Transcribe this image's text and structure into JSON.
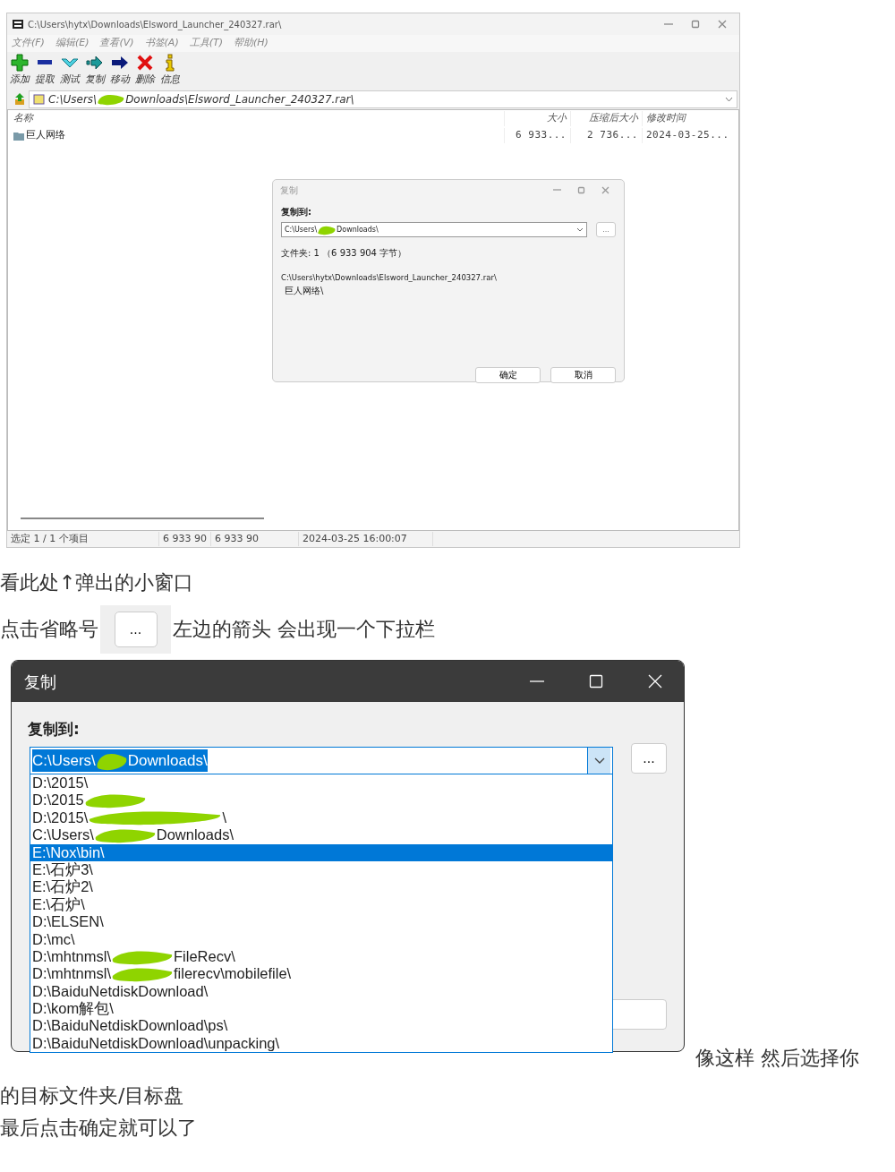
{
  "archive_window": {
    "title": "C:\\Users\\hytx\\Downloads\\Elsword_Launcher_240327.rar\\",
    "menu": [
      "文件(F)",
      "编辑(E)",
      "查看(V)",
      "书签(A)",
      "工具(T)",
      "帮助(H)"
    ],
    "toolbar": [
      "添加",
      "提取",
      "测试",
      "复制",
      "移动",
      "删除",
      "信息"
    ],
    "address": {
      "parts": [
        "C:\\Users\\",
        "Downloads\\Elsword_Launcher_240327.rar\\"
      ],
      "redacted": true
    },
    "columns": [
      "名称",
      "大小",
      "压缩后大小",
      "修改时间"
    ],
    "rows": [
      {
        "name": "巨人网络",
        "size": "6 933...",
        "packed": "2 736...",
        "modified": "2024-03-25..."
      }
    ],
    "status_bar": [
      "选定 1 / 1 个项目",
      "6 933 90",
      "6 933 90",
      "2024-03-25 16:00:07"
    ],
    "copy_dialog": {
      "title": "复制",
      "label": "复制到:",
      "destination": {
        "parts": [
          "C:\\Users\\",
          "Downloads\\"
        ],
        "redacted": true
      },
      "browse": "...",
      "info": "文件夹: 1 （6 933 904 字节）",
      "source": [
        "C:\\Users\\hytx\\Downloads\\Elsword_Launcher_240327.rar\\",
        "巨人网络\\"
      ],
      "buttons": [
        "确定",
        "取消"
      ]
    }
  },
  "caption_1": "看此处↑弹出的小窗口",
  "caption_2": {
    "before": "点击省略号",
    "button": "...",
    "after": "左边的箭头 会出现一个下拉栏"
  },
  "copy_dialog_zoomed": {
    "title": "复制",
    "label": "复制到:",
    "destination": {
      "parts": [
        "C:\\Users\\",
        "Downloads\\"
      ],
      "redacted": true,
      "highlighted": true
    },
    "browse": "...",
    "options": [
      {
        "parts": [
          "D:\\2015\\"
        ],
        "redacted": false,
        "selected": false
      },
      {
        "parts": [
          "D:\\2015"
        ],
        "redacted": true,
        "selected": false
      },
      {
        "parts": [
          "D:\\2015\\",
          "\\"
        ],
        "redacted": true,
        "selected": false
      },
      {
        "parts": [
          "C:\\Users\\",
          "Downloads\\"
        ],
        "redacted": true,
        "selected": false
      },
      {
        "parts": [
          "E:\\Nox\\bin\\"
        ],
        "redacted": false,
        "selected": true
      },
      {
        "parts": [
          "E:\\石炉3\\"
        ],
        "redacted": false,
        "selected": false
      },
      {
        "parts": [
          "E:\\石炉2\\"
        ],
        "redacted": false,
        "selected": false
      },
      {
        "parts": [
          "E:\\石炉\\"
        ],
        "redacted": false,
        "selected": false
      },
      {
        "parts": [
          "D:\\ELSEN\\"
        ],
        "redacted": false,
        "selected": false
      },
      {
        "parts": [
          "D:\\mc\\"
        ],
        "redacted": false,
        "selected": false
      },
      {
        "parts": [
          "D:\\mhtnmsl\\",
          "FileRecv\\"
        ],
        "redacted": true,
        "selected": false
      },
      {
        "parts": [
          "D:\\mhtnmsl\\",
          "filerecv\\mobilefile\\"
        ],
        "redacted": true,
        "selected": false
      },
      {
        "parts": [
          "D:\\BaiduNetdiskDownload\\"
        ],
        "redacted": false,
        "selected": false
      },
      {
        "parts": [
          "D:\\kom解包\\"
        ],
        "redacted": false,
        "selected": false
      },
      {
        "parts": [
          "D:\\BaiduNetdiskDownload\\ps\\"
        ],
        "redacted": false,
        "selected": false
      },
      {
        "parts": [
          "D:\\BaiduNetdiskDownload\\unpacking\\"
        ],
        "redacted": false,
        "selected": false
      }
    ]
  },
  "caption_3": [
    "像这样 然后选择你",
    "的目标文件夹/目标盘",
    "最后点击确定就可以了"
  ]
}
